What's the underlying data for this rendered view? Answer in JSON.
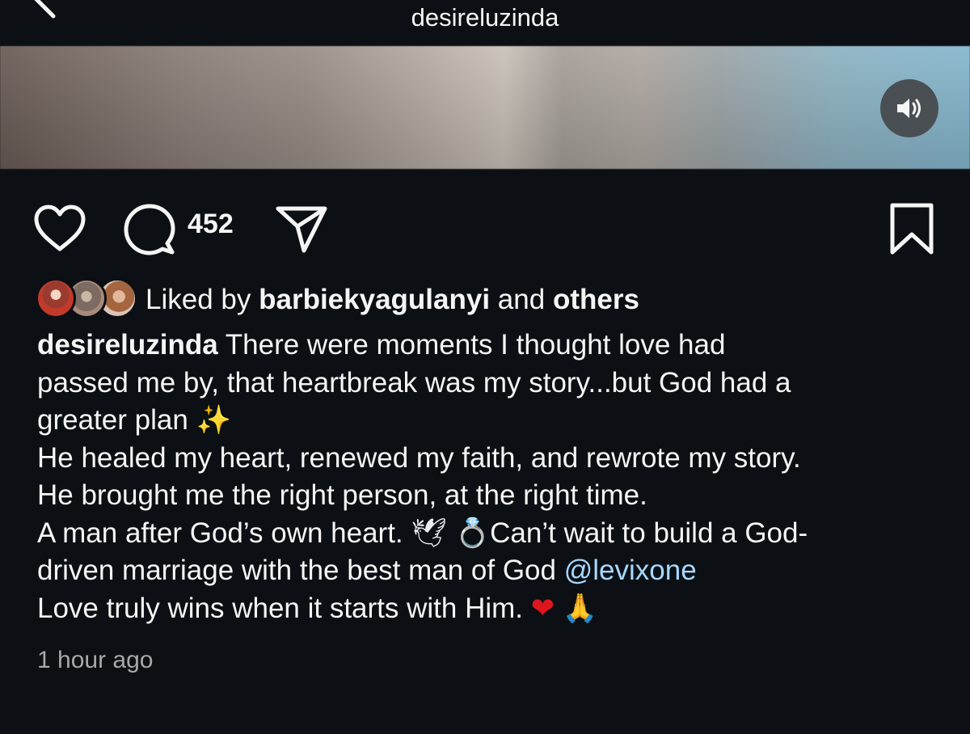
{
  "header": {
    "username": "desireluzinda",
    "back_icon": "chevron-left-icon"
  },
  "media": {
    "sound_icon": "speaker-icon"
  },
  "actions": {
    "like_icon": "heart-icon",
    "comment_icon": "comment-bubble-icon",
    "comment_count": "452",
    "share_icon": "paper-plane-icon",
    "save_icon": "bookmark-icon"
  },
  "likes": {
    "prefix": "Liked by",
    "user": "barbiekyagulanyi",
    "conjunction": "and",
    "others": "others"
  },
  "caption": {
    "author": "desireluzinda",
    "line1": " There were moments I thought love had",
    "line2": "passed me by, that heartbreak was my story...but God had a",
    "line3": "greater plan ",
    "sparkles_emoji": "✨",
    "line4": "He healed my heart, renewed my faith, and rewrote my story.",
    "line5": "He brought me the right person, at the right time.",
    "line6": "A man after God’s own heart. ",
    "dove_emoji": "🕊",
    "ring_emoji": "💍",
    "line6b": "Can’t wait to build a God-",
    "line7": "driven marriage with the best man of God ",
    "mention": "@levixone",
    "line8": "Love truly wins when it starts with Him. ",
    "heart_emoji": "❤",
    "pray_emoji": "🙏"
  },
  "timestamp": "1 hour ago",
  "colors": {
    "background": "#0c1014",
    "text": "#f5f5f5",
    "secondary_text": "#a8a8a8",
    "mention": "#a8d8ff"
  }
}
